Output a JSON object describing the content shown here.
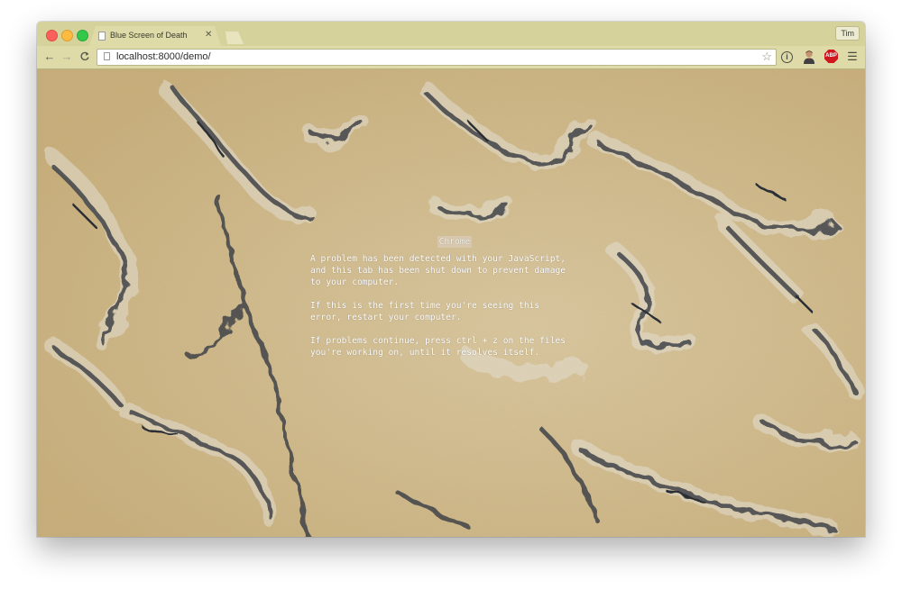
{
  "browser": {
    "tab_title": "Blue Screen of Death",
    "tab_close_icon": "close-icon",
    "profile_name": "Tim",
    "url": "localhost:8000/demo/",
    "nav_icons": [
      "back-arrow-icon",
      "forward-arrow-icon",
      "reload-icon"
    ],
    "toolbar_icons": [
      "info-icon",
      "person-icon",
      "adblock-plus-icon",
      "hamburger-menu-icon"
    ],
    "bookmark_icon": "star-icon"
  },
  "colors": {
    "chrome_frame": "#d9d6a4",
    "background_texture": "blue cheese",
    "text": "#ffffff"
  },
  "error_screen": {
    "title": "Chrome",
    "paragraph1": "A problem has been detected with your JavaScript,\nand this tab has been shut down to prevent damage\nto your computer.",
    "paragraph2": "If this is the first time you're seeing this\nerror, restart your computer.",
    "paragraph3": "If problems continue, press ctrl + z on the files\nyou're working on, until it resolves itself."
  }
}
